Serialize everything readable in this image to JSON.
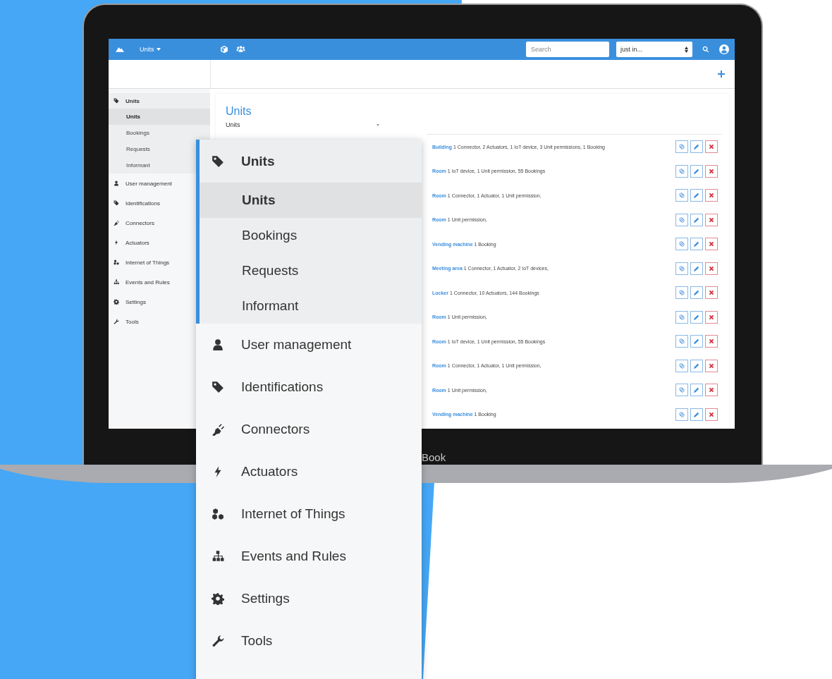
{
  "topbar": {
    "menu_label": "Units",
    "search": {
      "placeholder": "Search"
    },
    "scope_select": {
      "value": "just in..."
    }
  },
  "sidebar": {
    "sections": [
      {
        "label": "Units",
        "expanded": true,
        "children": [
          {
            "label": "Units",
            "selected": true
          },
          {
            "label": "Bookings",
            "selected": false
          },
          {
            "label": "Requests",
            "selected": false
          },
          {
            "label": "Informant",
            "selected": false
          }
        ]
      },
      {
        "label": "User management",
        "expanded": false
      },
      {
        "label": "Identifications",
        "expanded": false
      },
      {
        "label": "Connectors",
        "expanded": false
      },
      {
        "label": "Actuators",
        "expanded": false
      },
      {
        "label": "Internet of Things",
        "expanded": false
      },
      {
        "label": "Events and Rules",
        "expanded": false
      },
      {
        "label": "Settings",
        "expanded": false
      },
      {
        "label": "Tools",
        "expanded": false
      }
    ]
  },
  "page": {
    "title": "Units",
    "filter": {
      "value": "Units"
    }
  },
  "units": [
    {
      "text": "**Building** 1 Connector, 2 Actuators, 1 IoT device, 3 Unit permissions, 1 Booking"
    },
    {
      "text": "**Room** 1 IoT device, 1 Unit permission, 55 Bookings"
    },
    {
      "text": "**Room** 1 Connector, 1 Actuator, 1 Unit permission,"
    },
    {
      "text": "**Room** 1 Unit permission,"
    },
    {
      "text": "**Vending machine** 1 Booking"
    },
    {
      "text": "**Meeting area** 1 Connector, 1 Actuator, 2 IoT devices,"
    },
    {
      "text": "**Locker** 1 Connector, 10 Actuators, 144 Bookings"
    },
    {
      "text": "**Room** 1 Unit permission,"
    },
    {
      "text": "**Room** 1 IoT device, 1 Unit permission, 55 Bookings"
    },
    {
      "text": "**Room** 1 Connector, 1 Actuator, 1 Unit permission,"
    },
    {
      "text": "**Room** 1 Unit permission,"
    },
    {
      "text": "**Vending machine** 1 Booking"
    }
  ],
  "bezel_label": "Book",
  "magnified_sidebar": {
    "sections": [
      {
        "label": "Units",
        "expanded": true,
        "children": [
          {
            "label": "Units",
            "selected": true
          },
          {
            "label": "Bookings",
            "selected": false
          },
          {
            "label": "Requests",
            "selected": false
          },
          {
            "label": "Informant",
            "selected": false
          }
        ]
      },
      {
        "label": "User management",
        "expanded": false
      },
      {
        "label": "Identifications",
        "expanded": false
      },
      {
        "label": "Connectors",
        "expanded": false
      },
      {
        "label": "Actuators",
        "expanded": false
      },
      {
        "label": "Internet of Things",
        "expanded": false
      },
      {
        "label": "Events and Rules",
        "expanded": false
      },
      {
        "label": "Settings",
        "expanded": false
      },
      {
        "label": "Tools",
        "expanded": false
      }
    ]
  }
}
